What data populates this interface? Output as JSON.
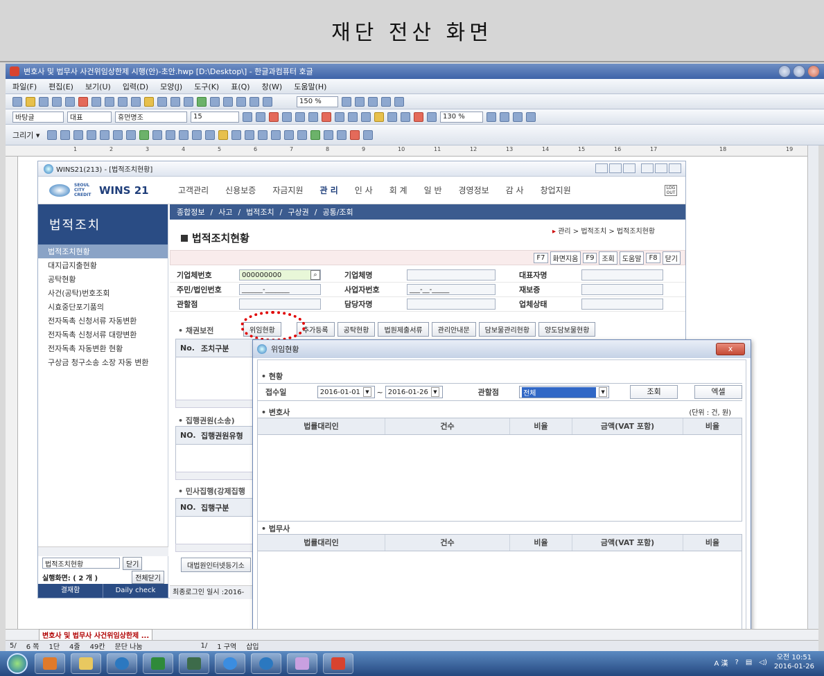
{
  "banner": {
    "title": "재단 전산 화면"
  },
  "hwp": {
    "title": "변호사 및 법무사 사건위임상한제 시행(안)-초안.hwp [D:\\Desktop\\] - 한글과컴퓨터 호글",
    "menu": [
      "파일(F)",
      "편집(E)",
      "보기(U)",
      "입력(D)",
      "모양(J)",
      "도구(K)",
      "표(Q)",
      "창(W)",
      "도움말(H)"
    ],
    "font_style": "바탕글",
    "font_rep": "대표",
    "font_name": "휴먼명조",
    "font_size": "15",
    "zoom": "150 %",
    "line_spacing": "130 %",
    "ruler": [
      "1",
      "2",
      "3",
      "4",
      "5",
      "6",
      "7",
      "8",
      "9",
      "10",
      "11",
      "12",
      "13",
      "14",
      "15",
      "16",
      "17",
      "18",
      "19"
    ],
    "doc_tab": "변호사 및 법무사 사건위임상한제 ...",
    "status": [
      "5/",
      "6 쪽",
      "1단",
      "4줄",
      "49칸",
      "문단 나눔",
      "1/",
      "1 구역",
      "삽입"
    ]
  },
  "wins": {
    "window_title": "WINS21(213) - [법적조치현황]",
    "logo": "WINS 21",
    "logo_small": "SEOUL CITY CREDIT",
    "logout": "LOG OUT",
    "topnav": [
      "고객관리",
      "신용보증",
      "자금지원",
      "관 리",
      "인 사",
      "회 계",
      "일 반",
      "경영정보",
      "감 사",
      "창업지원"
    ],
    "subnav": [
      "종합정보",
      "/",
      "사고",
      "/",
      "법적조치",
      "/",
      "구상권",
      "/",
      "공통/조회"
    ],
    "left_title": "법적조치",
    "left_items": [
      "법적조치현황",
      "대지급지출현황",
      "공탁현황",
      "사건(공탁)번호조회",
      "시효중단포기품의",
      "전자독촉 신청서류 자동변환",
      "전자독촉 신청서류 대량변환",
      "전자독촉 자동변환 현황",
      "구상금 청구소송 소장 자동 변환"
    ],
    "left_select": "법적조치현황",
    "close_label": "닫기",
    "running": "실행화면: ( 2 개 )",
    "close_all": "전체닫기",
    "foot": [
      "결재함",
      "Daily check"
    ],
    "last_login": "최종로그인 일시 :2016-",
    "page_title": "법적조치현황",
    "breadcrumb": "관리 > 법적조치 > 법적조치현황",
    "fn_buttons": [
      "F7",
      "화면지움",
      "F9",
      "조회",
      "도움말",
      "F8",
      "닫기"
    ],
    "form": {
      "biz_no_label": "기업체번호",
      "biz_no_value": "000000000",
      "biz_name_label": "기업체명",
      "rep_label": "대표자명",
      "rrn_label": "주민/법인번호",
      "rrn_value": "______-_______",
      "reg_label": "사업자번호",
      "reg_value": "___-__-_____",
      "cert_label": "재보증",
      "branch_label": "관할점",
      "manager_label": "담당자명",
      "status_label": "업체상태"
    },
    "sec1": "• 채권보전",
    "action_buttons": [
      "위임현황",
      "추가등록",
      "공탁현황",
      "법원제출서류",
      "관리안내문",
      "담보물관리현황",
      "양도담보물현황"
    ],
    "tbl1_head": [
      "No.",
      "조치구분"
    ],
    "sec2": "• 집행권원(소송)",
    "tbl2_head": [
      "NO.",
      "집행권원유형"
    ],
    "sec3": "• 민사집행(강제집행",
    "tbl3_head": [
      "NO.",
      "집행구분"
    ],
    "court_btn": "대법원인터넷등기소"
  },
  "popup": {
    "title": "위임현황",
    "close": "x",
    "sec_status": "• 현황",
    "recv_label": "접수일",
    "date_from": "2016-01-01",
    "tilde": "~",
    "date_to": "2016-01-26",
    "branch_label": "관할점",
    "branch_value": "전체",
    "search_btn": "조회",
    "excel_btn": "엑셀",
    "sec_lawyer": "• 변호사",
    "unit": "(단위 : 건, 원)",
    "cols": [
      "법률대리인",
      "건수",
      "비율",
      "금액(VAT 포함)",
      "비율"
    ],
    "sec_judicial": "• 법무사"
  },
  "tray": {
    "ime": "A 漢",
    "time": "오전 10:51",
    "date": "2016-01-26"
  },
  "colors": {
    "accent": "#2a4c84",
    "highlight": "#e00000"
  }
}
